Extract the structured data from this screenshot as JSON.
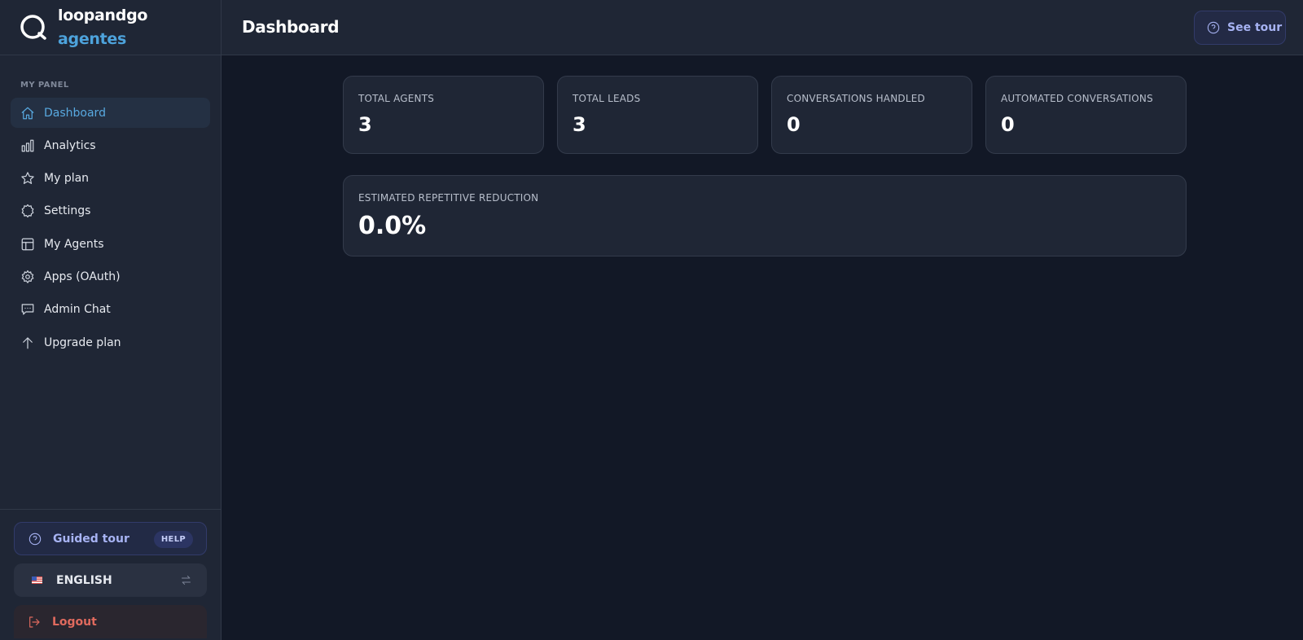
{
  "brand": {
    "name": "loopandgo",
    "sub": "agentes"
  },
  "sidebar": {
    "section_label": "MY PANEL",
    "items": [
      {
        "label": "Dashboard",
        "icon": "home-icon",
        "active": true
      },
      {
        "label": "Analytics",
        "icon": "bar-chart-icon"
      },
      {
        "label": "My plan",
        "icon": "star-icon"
      },
      {
        "label": "Settings",
        "icon": "gear-icon"
      },
      {
        "label": "My Agents",
        "icon": "layout-icon"
      },
      {
        "label": "Apps (OAuth)",
        "icon": "cog-icon"
      },
      {
        "label": "Admin Chat",
        "icon": "chat-icon"
      },
      {
        "label": "Upgrade plan",
        "icon": "arrow-up-icon"
      }
    ],
    "guided_tour": {
      "label": "Guided tour",
      "badge": "HELP"
    },
    "language": {
      "label": "ENGLISH",
      "flag": "us-flag"
    },
    "logout": {
      "label": "Logout"
    }
  },
  "header": {
    "title": "Dashboard",
    "see_tour": "See tour"
  },
  "stats": [
    {
      "label": "TOTAL AGENTS",
      "value": "3"
    },
    {
      "label": "TOTAL LEADS",
      "value": "3"
    },
    {
      "label": "CONVERSATIONS HANDLED",
      "value": "0"
    },
    {
      "label": "AUTOMATED CONVERSATIONS",
      "value": "0"
    }
  ],
  "reduction": {
    "label": "ESTIMATED REPETITIVE REDUCTION",
    "value": "0.0%"
  },
  "colors": {
    "accent": "#58a9e0",
    "brand_sub": "#4da3dc",
    "tour": "#a7b3f3",
    "logout": "#e06a5e",
    "background": "#121826",
    "panel": "#1f2635"
  }
}
